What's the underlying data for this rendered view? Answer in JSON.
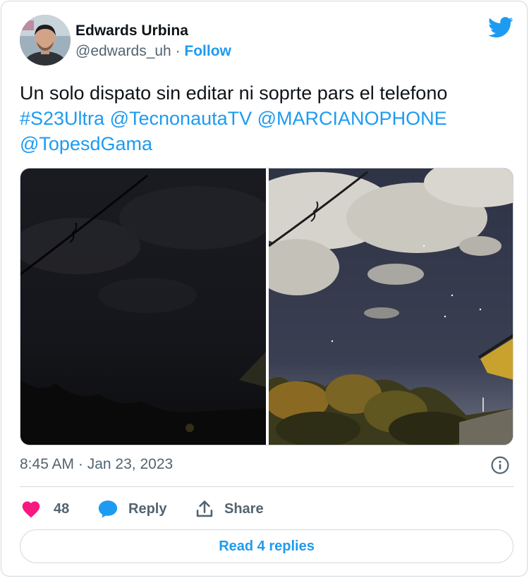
{
  "author": {
    "name": "Edwards Urbina",
    "handle": "@edwards_uh",
    "separator": " · ",
    "follow_label": "Follow"
  },
  "tweet": {
    "text": "Un solo dispato sin editar ni soprte pars el telefono",
    "tags": [
      "#S23Ultra",
      "@TecnonautaTV",
      "@MARCIANOPHONE",
      "@TopesdGama"
    ]
  },
  "meta": {
    "time": "8:45 AM",
    "separator": " · ",
    "date": "Jan 23, 2023"
  },
  "actions": {
    "likes": "48",
    "reply_label": "Reply",
    "share_label": "Share"
  },
  "read_replies_label": "Read 4 replies",
  "colors": {
    "accent": "#1d9bf0",
    "like": "#f91880",
    "muted": "#536471"
  },
  "icons": [
    "twitter-bird-icon",
    "info-icon",
    "heart-icon",
    "reply-bubble-icon",
    "share-icon"
  ]
}
